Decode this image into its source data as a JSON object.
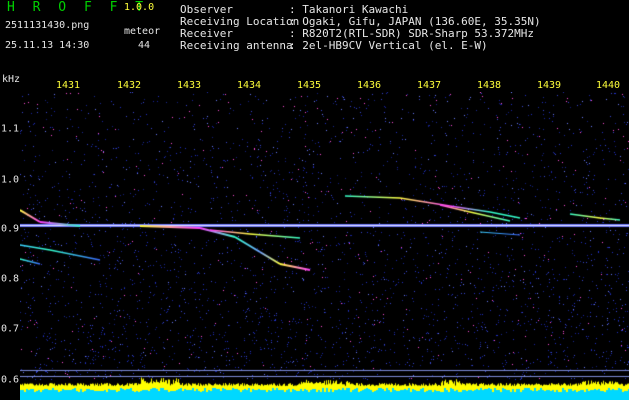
{
  "header": {
    "app_title": "H R O F F T",
    "version": "1.0.0",
    "filename": "2511131430.png",
    "meteor_label": "meteor",
    "datetime": "25.11.13 14:30",
    "meteor_count": "44",
    "info": [
      {
        "label": "Observer",
        "value": ": Takanori Kawachi"
      },
      {
        "label": "Receiving Location",
        "value": ": Ogaki, Gifu, JAPAN (136.60E, 35.35N)"
      },
      {
        "label": "Receiver",
        "value": ": R820T2(RTL-SDR) SDR-Sharp 53.372MHz"
      },
      {
        "label": "Receiving antenna",
        "value": ": 2el-HB9CV Vertical (el. E-W)"
      }
    ]
  },
  "axes": {
    "y_unit": "kHz",
    "x_ticks": [
      "1431",
      "1432",
      "1433",
      "1434",
      "1435",
      "1436",
      "1437",
      "1438",
      "1439",
      "1440"
    ],
    "y_ticks": [
      "1.1",
      "1.0",
      "0.9",
      "0.8",
      "0.7",
      "0.6"
    ]
  },
  "colors": {
    "background": "#000000",
    "noise": "#1a24a8",
    "carrier": "#e0e0ff",
    "echo_hot": "#ff3cff",
    "echo_warm": "#ffff40",
    "echo_cool": "#33ffcc",
    "baseline_yellow": "#ffff00",
    "baseline_cyan": "#00d8ff"
  }
}
